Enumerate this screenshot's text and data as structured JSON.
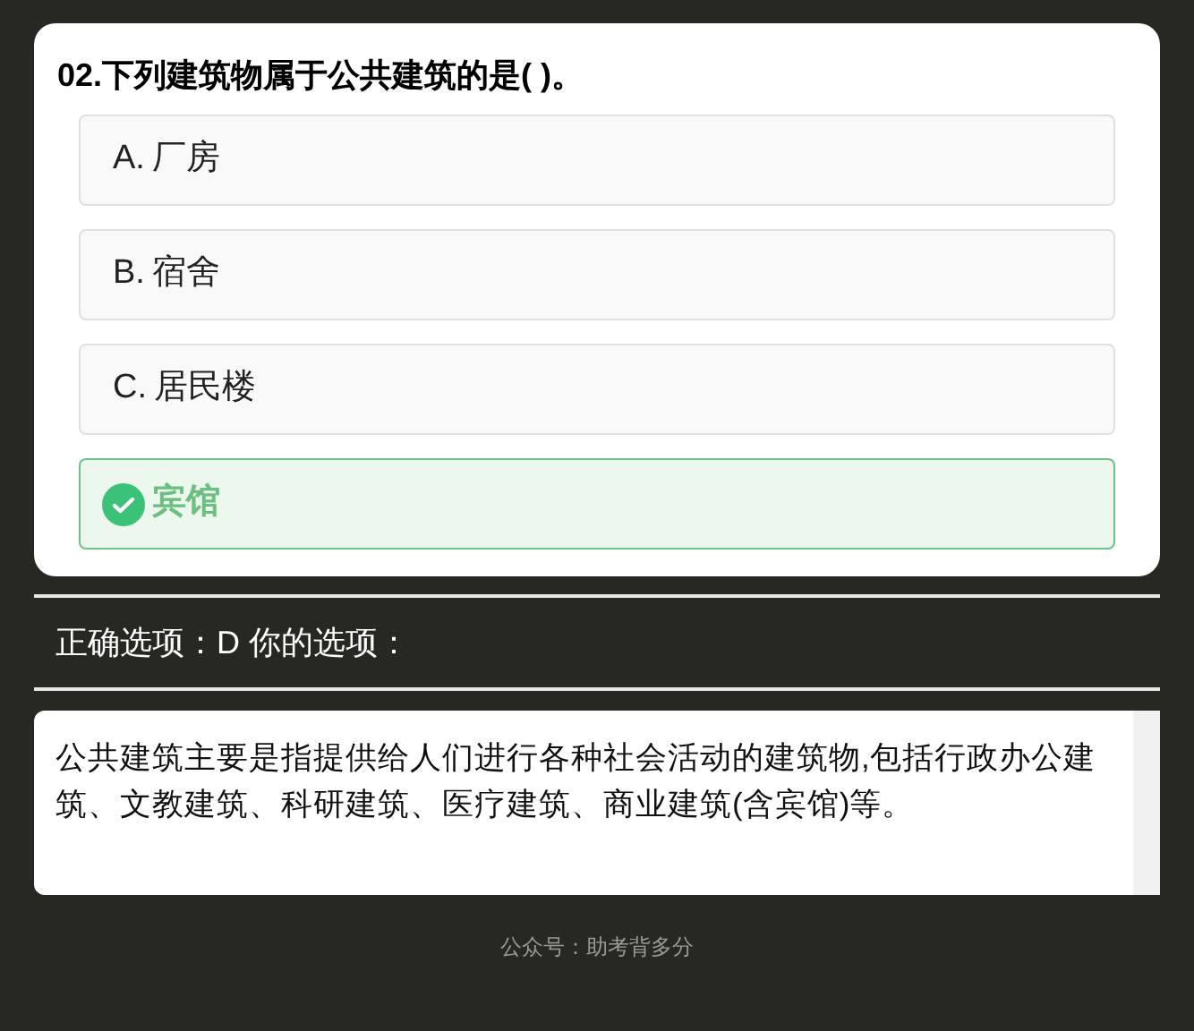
{
  "question": {
    "title": "02.下列建筑物属于公共建筑的是( )。",
    "options": [
      {
        "letter": "A.",
        "text": "厂房",
        "correct": false
      },
      {
        "letter": "B.",
        "text": "宿舍",
        "correct": false
      },
      {
        "letter": "C.",
        "text": "居民楼",
        "correct": false
      },
      {
        "text": "宾馆",
        "correct": true
      }
    ]
  },
  "answer_line": "正确选项：D 你的选项：",
  "explanation": "公共建筑主要是指提供给人们进行各种社会活动的建筑物,包括行政办公建筑、文教建筑、科研建筑、医疗建筑、商业建筑(含宾馆)等。",
  "footer": "公众号：助考背多分"
}
